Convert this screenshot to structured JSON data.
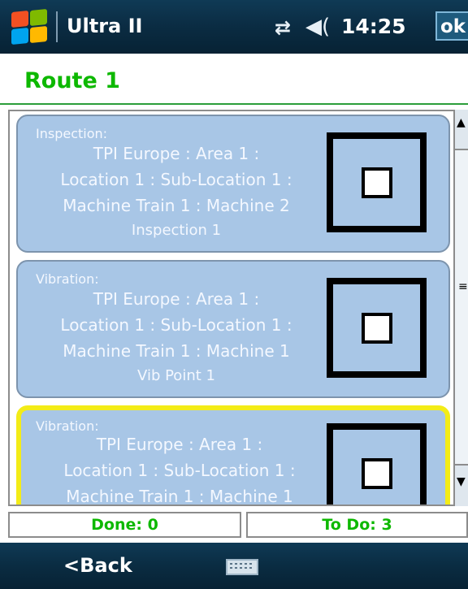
{
  "topbar": {
    "app_title": "Ultra II",
    "clock": "14:25",
    "ok_label": "ok",
    "icons": [
      "windows-start-icon",
      "connectivity-icon",
      "speaker-icon"
    ]
  },
  "route": {
    "title": "Route 1"
  },
  "points": [
    {
      "type": "Inspection:",
      "lines": [
        "TPI Europe : Area 1 :",
        "Location 1 : Sub-Location 1 :",
        "Machine Train 1 : Machine 2",
        "Inspection 1"
      ],
      "selected": false
    },
    {
      "type": "Vibration:",
      "lines": [
        "TPI Europe : Area 1 :",
        "Location 1 : Sub-Location 1 :",
        "Machine Train 1 : Machine 1",
        "Vib Point 1"
      ],
      "selected": false
    },
    {
      "type": "Vibration:",
      "lines": [
        "TPI Europe : Area 1 :",
        "Location 1 : Sub-Location 1 :",
        "Machine Train 1 : Machine 1",
        ""
      ],
      "selected": true
    }
  ],
  "counters": {
    "done": "Done: 0",
    "todo": "To Do: 3"
  },
  "softkeys": {
    "back_label": "<Back",
    "keyboard_icon": "keyboard-icon"
  },
  "colors": {
    "accent_green": "#0db800",
    "card_blue": "#a8c6e6",
    "selection_yellow": "#f3ec17",
    "bar_navy": "#0b2d44"
  }
}
